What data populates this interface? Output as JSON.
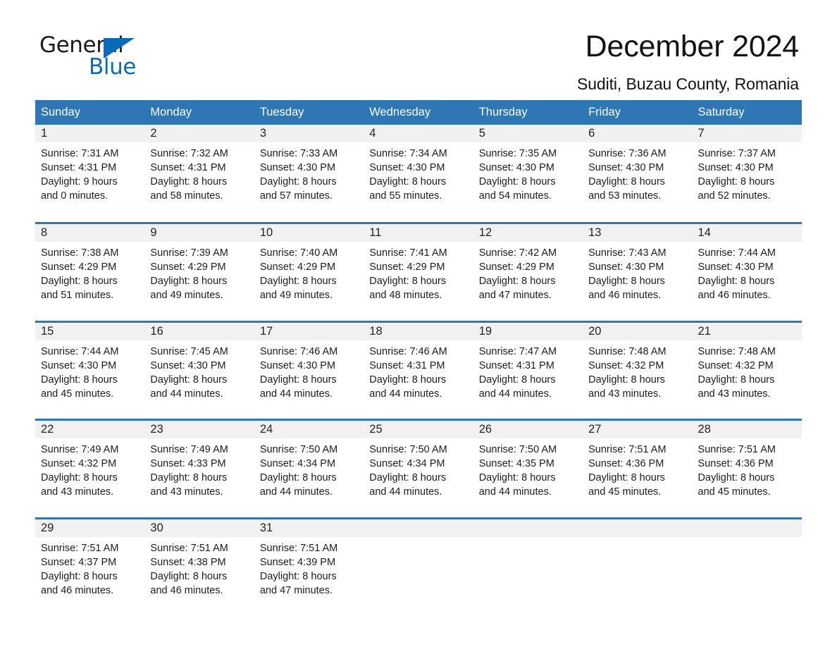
{
  "brand": {
    "name_part1": "General",
    "name_part2": "Blue",
    "triangle_color": "#0b6bbb"
  },
  "header": {
    "title": "December 2024",
    "subtitle": "Suditi, Buzau County, Romania"
  },
  "theme": {
    "header_blue": "#2f76b4",
    "daynum_gray": "#f1f1f1",
    "text": "#1c1c1c"
  },
  "weekday_headers": [
    "Sunday",
    "Monday",
    "Tuesday",
    "Wednesday",
    "Thursday",
    "Friday",
    "Saturday"
  ],
  "weeks": [
    [
      {
        "day": "1",
        "sunrise": "Sunrise: 7:31 AM",
        "sunset": "Sunset: 4:31 PM",
        "daylight_line1": "Daylight: 9 hours",
        "daylight_line2": "and 0 minutes."
      },
      {
        "day": "2",
        "sunrise": "Sunrise: 7:32 AM",
        "sunset": "Sunset: 4:31 PM",
        "daylight_line1": "Daylight: 8 hours",
        "daylight_line2": "and 58 minutes."
      },
      {
        "day": "3",
        "sunrise": "Sunrise: 7:33 AM",
        "sunset": "Sunset: 4:30 PM",
        "daylight_line1": "Daylight: 8 hours",
        "daylight_line2": "and 57 minutes."
      },
      {
        "day": "4",
        "sunrise": "Sunrise: 7:34 AM",
        "sunset": "Sunset: 4:30 PM",
        "daylight_line1": "Daylight: 8 hours",
        "daylight_line2": "and 55 minutes."
      },
      {
        "day": "5",
        "sunrise": "Sunrise: 7:35 AM",
        "sunset": "Sunset: 4:30 PM",
        "daylight_line1": "Daylight: 8 hours",
        "daylight_line2": "and 54 minutes."
      },
      {
        "day": "6",
        "sunrise": "Sunrise: 7:36 AM",
        "sunset": "Sunset: 4:30 PM",
        "daylight_line1": "Daylight: 8 hours",
        "daylight_line2": "and 53 minutes."
      },
      {
        "day": "7",
        "sunrise": "Sunrise: 7:37 AM",
        "sunset": "Sunset: 4:30 PM",
        "daylight_line1": "Daylight: 8 hours",
        "daylight_line2": "and 52 minutes."
      }
    ],
    [
      {
        "day": "8",
        "sunrise": "Sunrise: 7:38 AM",
        "sunset": "Sunset: 4:29 PM",
        "daylight_line1": "Daylight: 8 hours",
        "daylight_line2": "and 51 minutes."
      },
      {
        "day": "9",
        "sunrise": "Sunrise: 7:39 AM",
        "sunset": "Sunset: 4:29 PM",
        "daylight_line1": "Daylight: 8 hours",
        "daylight_line2": "and 49 minutes."
      },
      {
        "day": "10",
        "sunrise": "Sunrise: 7:40 AM",
        "sunset": "Sunset: 4:29 PM",
        "daylight_line1": "Daylight: 8 hours",
        "daylight_line2": "and 49 minutes."
      },
      {
        "day": "11",
        "sunrise": "Sunrise: 7:41 AM",
        "sunset": "Sunset: 4:29 PM",
        "daylight_line1": "Daylight: 8 hours",
        "daylight_line2": "and 48 minutes."
      },
      {
        "day": "12",
        "sunrise": "Sunrise: 7:42 AM",
        "sunset": "Sunset: 4:29 PM",
        "daylight_line1": "Daylight: 8 hours",
        "daylight_line2": "and 47 minutes."
      },
      {
        "day": "13",
        "sunrise": "Sunrise: 7:43 AM",
        "sunset": "Sunset: 4:30 PM",
        "daylight_line1": "Daylight: 8 hours",
        "daylight_line2": "and 46 minutes."
      },
      {
        "day": "14",
        "sunrise": "Sunrise: 7:44 AM",
        "sunset": "Sunset: 4:30 PM",
        "daylight_line1": "Daylight: 8 hours",
        "daylight_line2": "and 46 minutes."
      }
    ],
    [
      {
        "day": "15",
        "sunrise": "Sunrise: 7:44 AM",
        "sunset": "Sunset: 4:30 PM",
        "daylight_line1": "Daylight: 8 hours",
        "daylight_line2": "and 45 minutes."
      },
      {
        "day": "16",
        "sunrise": "Sunrise: 7:45 AM",
        "sunset": "Sunset: 4:30 PM",
        "daylight_line1": "Daylight: 8 hours",
        "daylight_line2": "and 44 minutes."
      },
      {
        "day": "17",
        "sunrise": "Sunrise: 7:46 AM",
        "sunset": "Sunset: 4:30 PM",
        "daylight_line1": "Daylight: 8 hours",
        "daylight_line2": "and 44 minutes."
      },
      {
        "day": "18",
        "sunrise": "Sunrise: 7:46 AM",
        "sunset": "Sunset: 4:31 PM",
        "daylight_line1": "Daylight: 8 hours",
        "daylight_line2": "and 44 minutes."
      },
      {
        "day": "19",
        "sunrise": "Sunrise: 7:47 AM",
        "sunset": "Sunset: 4:31 PM",
        "daylight_line1": "Daylight: 8 hours",
        "daylight_line2": "and 44 minutes."
      },
      {
        "day": "20",
        "sunrise": "Sunrise: 7:48 AM",
        "sunset": "Sunset: 4:32 PM",
        "daylight_line1": "Daylight: 8 hours",
        "daylight_line2": "and 43 minutes."
      },
      {
        "day": "21",
        "sunrise": "Sunrise: 7:48 AM",
        "sunset": "Sunset: 4:32 PM",
        "daylight_line1": "Daylight: 8 hours",
        "daylight_line2": "and 43 minutes."
      }
    ],
    [
      {
        "day": "22",
        "sunrise": "Sunrise: 7:49 AM",
        "sunset": "Sunset: 4:32 PM",
        "daylight_line1": "Daylight: 8 hours",
        "daylight_line2": "and 43 minutes."
      },
      {
        "day": "23",
        "sunrise": "Sunrise: 7:49 AM",
        "sunset": "Sunset: 4:33 PM",
        "daylight_line1": "Daylight: 8 hours",
        "daylight_line2": "and 43 minutes."
      },
      {
        "day": "24",
        "sunrise": "Sunrise: 7:50 AM",
        "sunset": "Sunset: 4:34 PM",
        "daylight_line1": "Daylight: 8 hours",
        "daylight_line2": "and 44 minutes."
      },
      {
        "day": "25",
        "sunrise": "Sunrise: 7:50 AM",
        "sunset": "Sunset: 4:34 PM",
        "daylight_line1": "Daylight: 8 hours",
        "daylight_line2": "and 44 minutes."
      },
      {
        "day": "26",
        "sunrise": "Sunrise: 7:50 AM",
        "sunset": "Sunset: 4:35 PM",
        "daylight_line1": "Daylight: 8 hours",
        "daylight_line2": "and 44 minutes."
      },
      {
        "day": "27",
        "sunrise": "Sunrise: 7:51 AM",
        "sunset": "Sunset: 4:36 PM",
        "daylight_line1": "Daylight: 8 hours",
        "daylight_line2": "and 45 minutes."
      },
      {
        "day": "28",
        "sunrise": "Sunrise: 7:51 AM",
        "sunset": "Sunset: 4:36 PM",
        "daylight_line1": "Daylight: 8 hours",
        "daylight_line2": "and 45 minutes."
      }
    ],
    [
      {
        "day": "29",
        "sunrise": "Sunrise: 7:51 AM",
        "sunset": "Sunset: 4:37 PM",
        "daylight_line1": "Daylight: 8 hours",
        "daylight_line2": "and 46 minutes."
      },
      {
        "day": "30",
        "sunrise": "Sunrise: 7:51 AM",
        "sunset": "Sunset: 4:38 PM",
        "daylight_line1": "Daylight: 8 hours",
        "daylight_line2": "and 46 minutes."
      },
      {
        "day": "31",
        "sunrise": "Sunrise: 7:51 AM",
        "sunset": "Sunset: 4:39 PM",
        "daylight_line1": "Daylight: 8 hours",
        "daylight_line2": "and 47 minutes."
      },
      {
        "day": "",
        "sunrise": "",
        "sunset": "",
        "daylight_line1": "",
        "daylight_line2": ""
      },
      {
        "day": "",
        "sunrise": "",
        "sunset": "",
        "daylight_line1": "",
        "daylight_line2": ""
      },
      {
        "day": "",
        "sunrise": "",
        "sunset": "",
        "daylight_line1": "",
        "daylight_line2": ""
      },
      {
        "day": "",
        "sunrise": "",
        "sunset": "",
        "daylight_line1": "",
        "daylight_line2": ""
      }
    ]
  ]
}
